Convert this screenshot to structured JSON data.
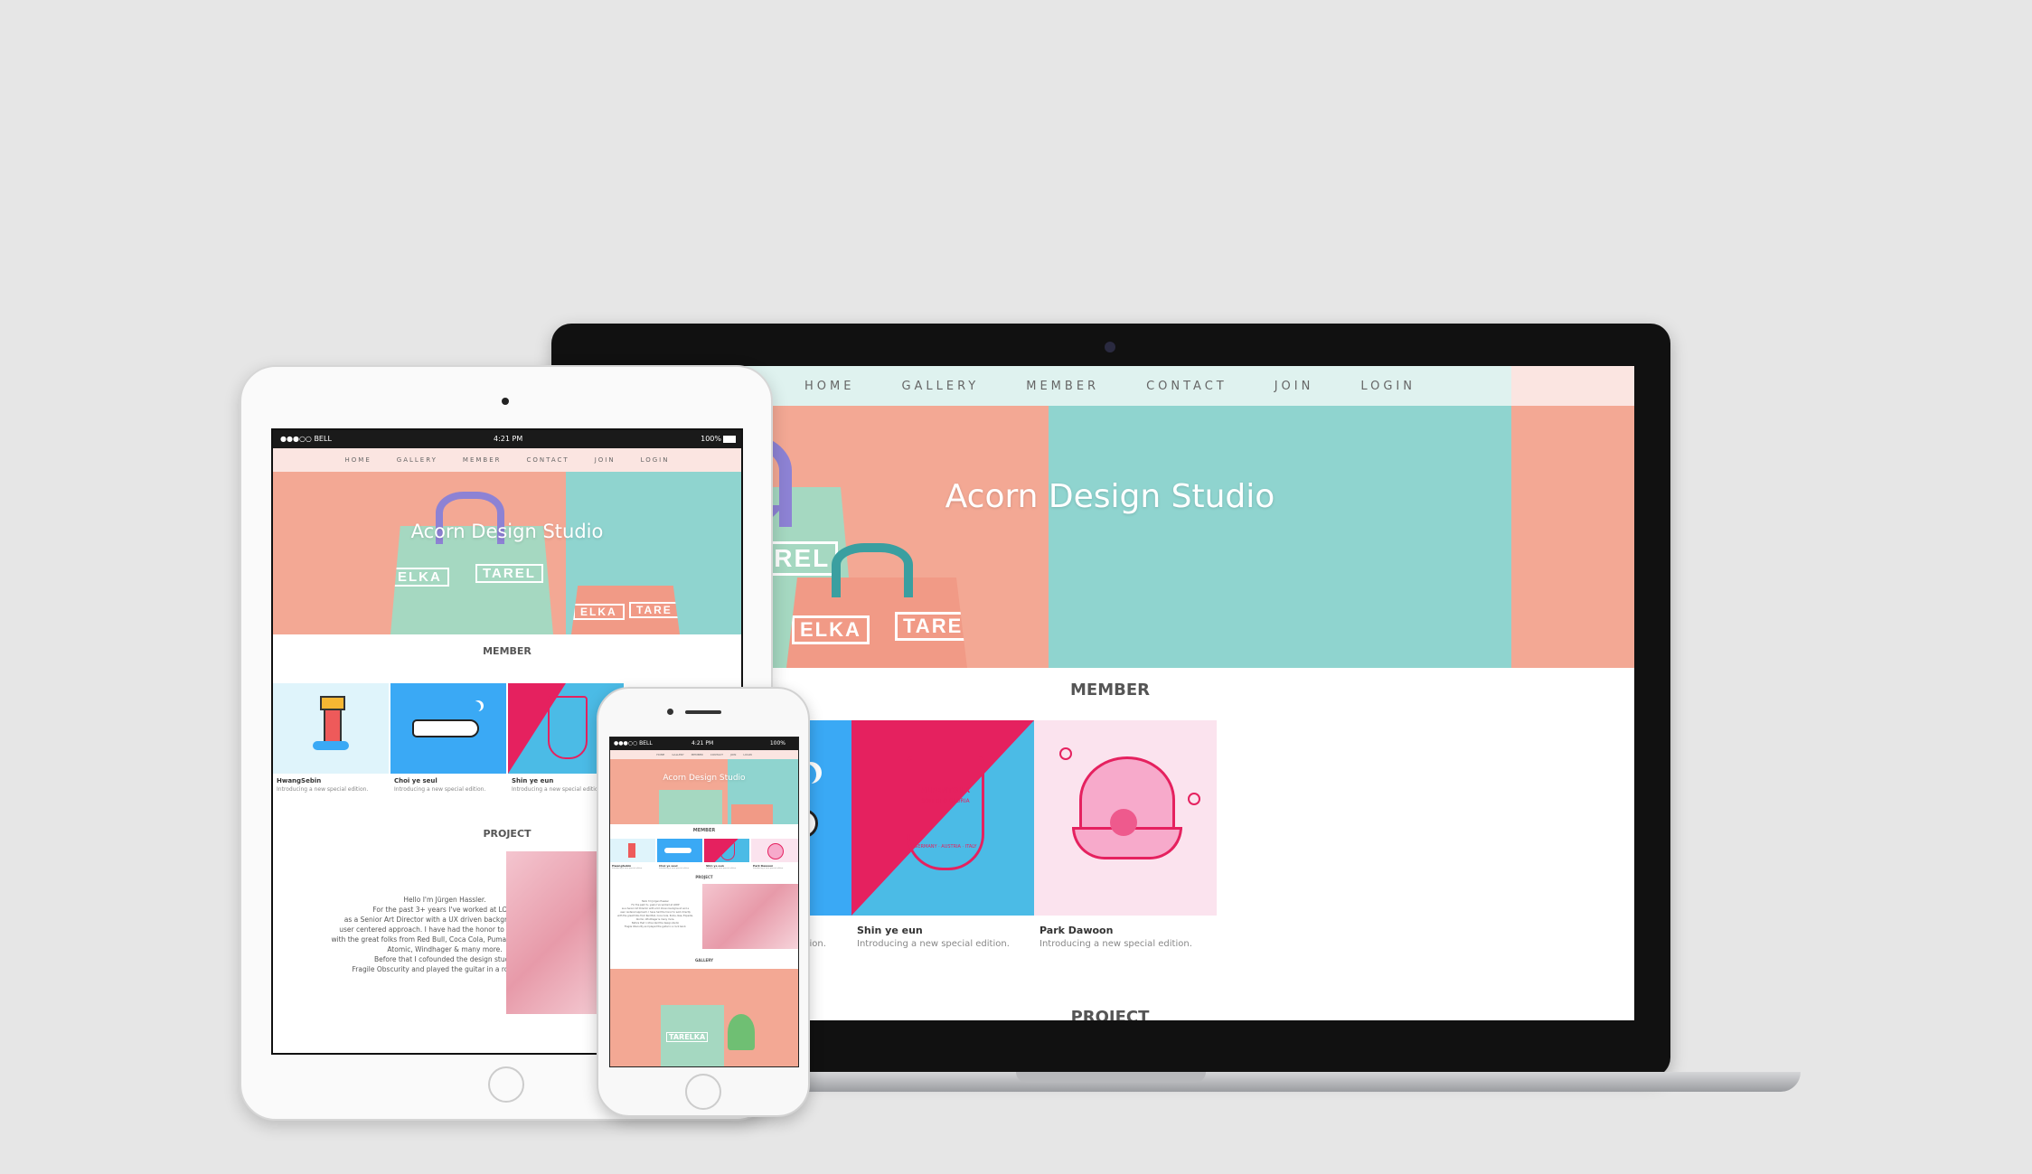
{
  "nav": [
    "HOME",
    "GALLERY",
    "MEMBER",
    "CONTACT",
    "JOIN",
    "LOGIN"
  ],
  "hero": {
    "title": "Acorn Design Studio"
  },
  "status_bar": {
    "carrier": "●●●○○ BELL",
    "time": "4:21 PM",
    "battery": "100%"
  },
  "sections": {
    "member": "MEMBER",
    "project": "PROJECT",
    "gallery": "GALLERY"
  },
  "members": [
    {
      "name": "HwangSebin",
      "desc": "Introducing a new special edition.",
      "icon": "lighthouse-icon"
    },
    {
      "name": "Choi ye seul",
      "desc": "Introducing a new special edition.",
      "icon": "airplane-icon"
    },
    {
      "name": "Shin ye eun",
      "desc": "Introducing a new special edition.",
      "icon": "alpentour-badge-icon"
    },
    {
      "name": "Park Dawoon",
      "desc": "Introducing a new special edition.",
      "icon": "pearl-shell-icon"
    }
  ],
  "badge": {
    "top": "ALPENTOUR",
    "sub": "SOLI DEO GLORIA",
    "bottom": "GERMANY · AUSTRIA · ITALY"
  },
  "bag_labels": {
    "a": "ELKA",
    "b": "TAREL",
    "c": "TARE",
    "d": "TARELKA"
  },
  "about_text": [
    "Hello I'm Jürgen Hassler.",
    "For the past 3+ years I've worked at LODP",
    "as a Senior Art Director with a UX driven background and a",
    "user centered approach. I have had the honor to work directly",
    "with the great folks from Red Bull, Coca Cola, Puma, Ikea, Expedia,",
    "Atomic, Windhager & many more.",
    "Before that I cofounded the design studio",
    "Fragile Obscurity and played the guitar in a rock band."
  ],
  "colors": {
    "bg": "#e6e6e6",
    "salmon": "#f3a894",
    "teal": "#8fd4cf",
    "mint": "#dff3ef",
    "blue": "#3aa9f5",
    "cyan": "#4bbbe6",
    "pink": "#e5215f",
    "lightpink": "#fbe3ee",
    "nav_pink": "#fbe5e1"
  }
}
